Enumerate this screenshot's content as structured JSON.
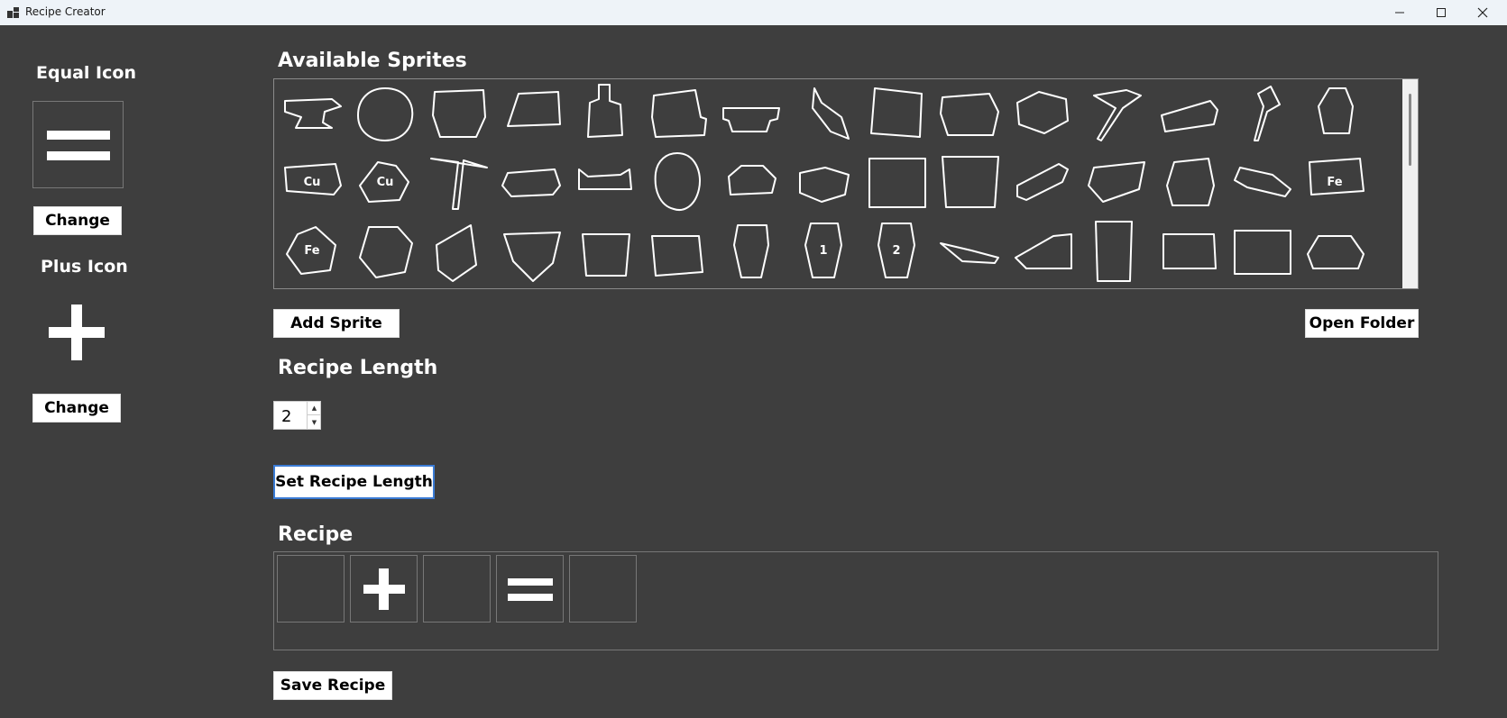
{
  "window": {
    "title": "Recipe Creator"
  },
  "sidebar": {
    "equal_heading": "Equal Icon",
    "equal_change_label": "Change",
    "plus_heading": "Plus Icon",
    "plus_change_label": "Change"
  },
  "sprites": {
    "heading": "Available Sprites",
    "items": [
      {
        "name": "anvil-icon"
      },
      {
        "name": "apple-icon"
      },
      {
        "name": "stone-block-icon"
      },
      {
        "name": "plank-icon"
      },
      {
        "name": "bottle-icon"
      },
      {
        "name": "chair-icon"
      },
      {
        "name": "bench-icon"
      },
      {
        "name": "carrot-icon"
      },
      {
        "name": "tile-icon"
      },
      {
        "name": "rock-icon"
      },
      {
        "name": "machine-icon"
      },
      {
        "name": "hammer-icon"
      },
      {
        "name": "bar-icon"
      },
      {
        "name": "axe-icon"
      },
      {
        "name": "sack-icon"
      },
      {
        "name": "copper-ingot-icon",
        "label": "Cu"
      },
      {
        "name": "copper-ore-icon",
        "label": "Cu"
      },
      {
        "name": "pickaxe-icon"
      },
      {
        "name": "slab-icon"
      },
      {
        "name": "bone-icon"
      },
      {
        "name": "egg-icon"
      },
      {
        "name": "bread-icon"
      },
      {
        "name": "pebble-icon"
      },
      {
        "name": "mesh-icon"
      },
      {
        "name": "basket-icon"
      },
      {
        "name": "sticks-icon"
      },
      {
        "name": "shard-icon"
      },
      {
        "name": "ore-chunk-icon"
      },
      {
        "name": "saw-icon"
      },
      {
        "name": "iron-ingot-icon",
        "label": "Fe"
      },
      {
        "name": "iron-ore-icon",
        "label": "Fe"
      },
      {
        "name": "boulder-icon"
      },
      {
        "name": "phone-icon"
      },
      {
        "name": "shield-icon"
      },
      {
        "name": "pot-icon"
      },
      {
        "name": "crucible-icon"
      },
      {
        "name": "vase-icon"
      },
      {
        "name": "jar-1-icon",
        "label": "1"
      },
      {
        "name": "jar-2-icon",
        "label": "2"
      },
      {
        "name": "knife-icon"
      },
      {
        "name": "wedge-icon"
      },
      {
        "name": "pillar-icon"
      },
      {
        "name": "cushion-icon"
      },
      {
        "name": "bed-frame-icon"
      },
      {
        "name": "trapezoid-icon"
      }
    ]
  },
  "buttons": {
    "add_sprite": "Add Sprite",
    "open_folder": "Open Folder",
    "set_length": "Set Recipe Length",
    "save_recipe": "Save Recipe"
  },
  "recipe_length": {
    "heading": "Recipe Length",
    "value": "2"
  },
  "recipe": {
    "heading": "Recipe",
    "slots": [
      "empty",
      "plus-icon",
      "empty",
      "equal-icon",
      "empty"
    ]
  }
}
